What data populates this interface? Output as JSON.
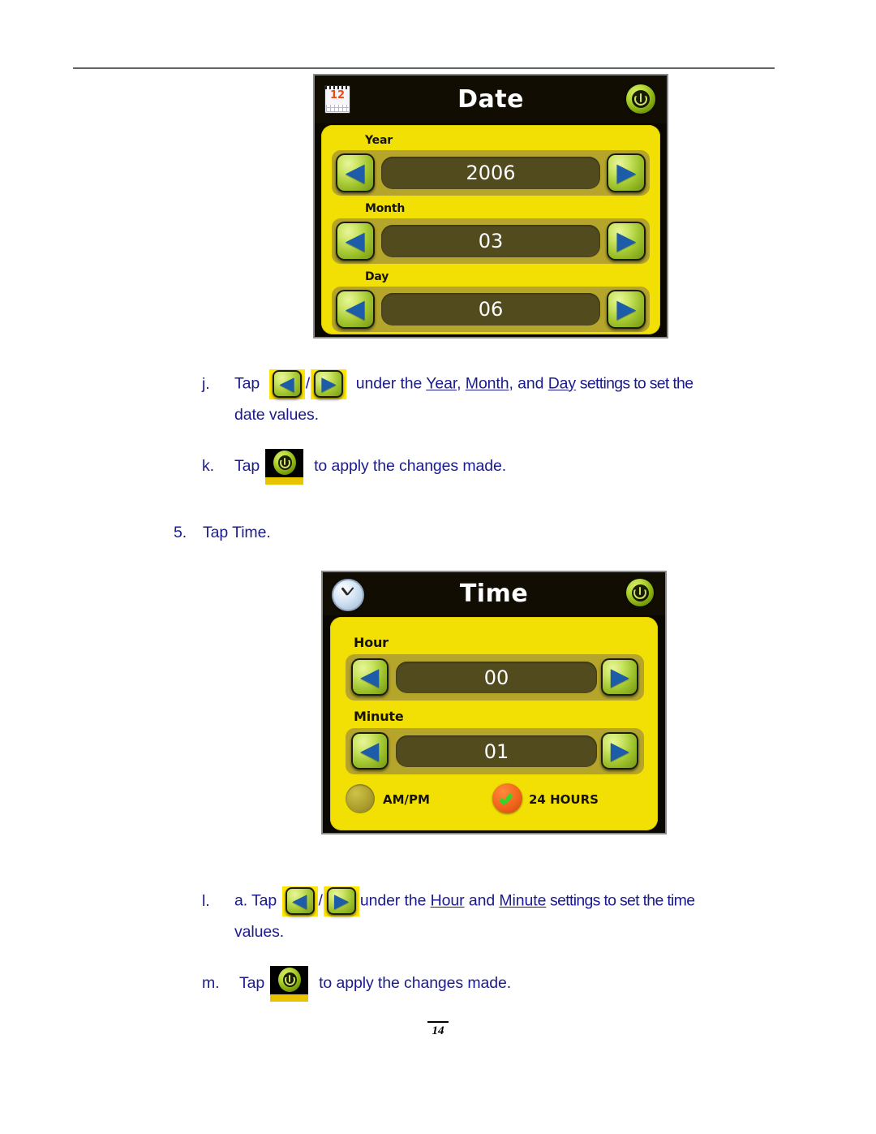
{
  "page": {
    "number": "14"
  },
  "date_screen": {
    "title": "Date",
    "icon": "calendar-icon",
    "calendar_day": "12",
    "power_icon": "power-icon",
    "fields": [
      {
        "label": "Year",
        "value": "2006",
        "prev": "◀",
        "next": "▶"
      },
      {
        "label": "Month",
        "value": "03",
        "prev": "◀",
        "next": "▶"
      },
      {
        "label": "Day",
        "value": "06",
        "prev": "◀",
        "next": "▶"
      }
    ]
  },
  "time_screen": {
    "title": "Time",
    "icon": "clock-icon",
    "power_icon": "power-icon",
    "fields": [
      {
        "label": "Hour",
        "value": "00",
        "prev": "◀",
        "next": "▶"
      },
      {
        "label": "Minute",
        "value": "01",
        "prev": "◀",
        "next": "▶"
      }
    ],
    "options": [
      {
        "label": "AM/PM",
        "selected": false
      },
      {
        "label": "24 HOURS",
        "selected": true
      }
    ]
  },
  "instructions": {
    "j": {
      "marker": "j.",
      "tap": "Tap",
      "separator": "/",
      "tail": "under the ",
      "link1": "Year",
      "comma1": ", ",
      "link2": "Month",
      "comma2": ", and ",
      "link3": "Day",
      "tail2": " settings to set the",
      "line2": "date values."
    },
    "k": {
      "marker": "k.",
      "tap": "Tap",
      "tail": "to apply the changes made."
    },
    "step5": {
      "marker": "5.",
      "text": "Tap Time."
    },
    "l": {
      "marker": "l.",
      "tap": "a. Tap",
      "separator": "/",
      "tail": "under the ",
      "link1": "Hour",
      "conj": " and ",
      "link2": "Minute",
      "tail2": " settings to set the time",
      "line2": "values."
    },
    "m": {
      "marker": "m.",
      "tap": "Tap",
      "tail": "to apply the changes made."
    }
  },
  "colors": {
    "text": "#1b1b8f",
    "panel_yellow": "#f2e004",
    "row_olive": "#b5a52b",
    "value_dark": "#514b1e",
    "chevron_blue": "#1d5ca8",
    "rule_gray": "#636363"
  }
}
